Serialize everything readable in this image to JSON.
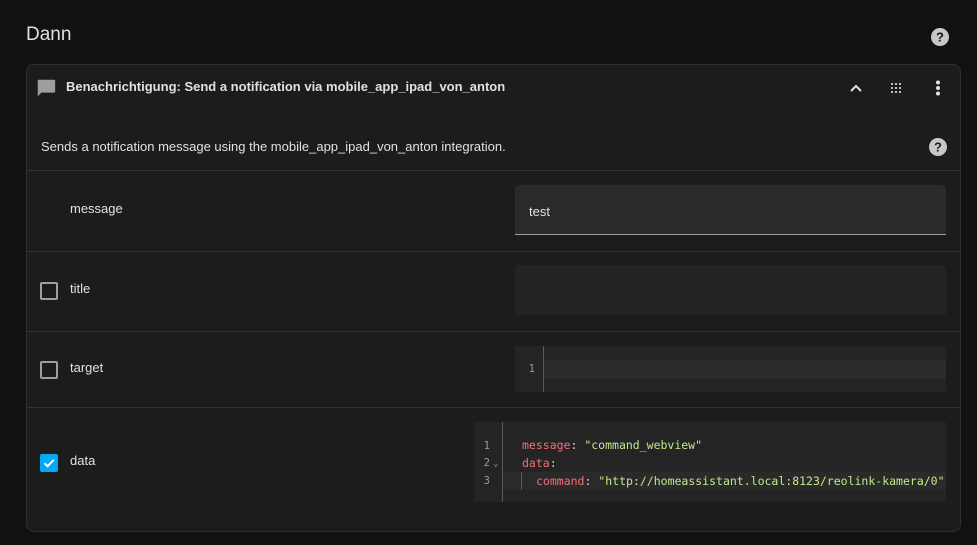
{
  "section": {
    "title": "Dann"
  },
  "card": {
    "header_title": "Benachrichtigung: Send a notification via mobile_app_ipad_von_anton",
    "description": "Sends a notification message using the mobile_app_ipad_von_anton integration."
  },
  "fields": {
    "message": {
      "label": "message",
      "value": "test",
      "enabled": true
    },
    "title": {
      "label": "title",
      "value": "",
      "checked": false
    },
    "target": {
      "label": "target",
      "checked": false,
      "line_numbers": [
        "1"
      ]
    },
    "data": {
      "label": "data",
      "checked": true,
      "line_numbers": [
        "1",
        "2",
        "3"
      ],
      "lines": [
        {
          "key": "message",
          "sep": ": ",
          "value": "\"command_webview\""
        },
        {
          "key": "data",
          "sep": ":",
          "value": ""
        },
        {
          "key": "command",
          "sep": ": ",
          "value": "\"http://homeassistant.local:8123/reolink-kamera/0\""
        }
      ]
    }
  },
  "colors": {
    "accent": "#03a9f4",
    "key": "#f07178",
    "string": "#c3e88d",
    "background": "#111111",
    "card": "#1c1c1c"
  },
  "icons": [
    "help-circle-icon",
    "chat-icon",
    "chevron-up-icon",
    "drag-handle-icon",
    "more-vertical-icon",
    "checkbox-icon",
    "fold-chevron-icon"
  ]
}
